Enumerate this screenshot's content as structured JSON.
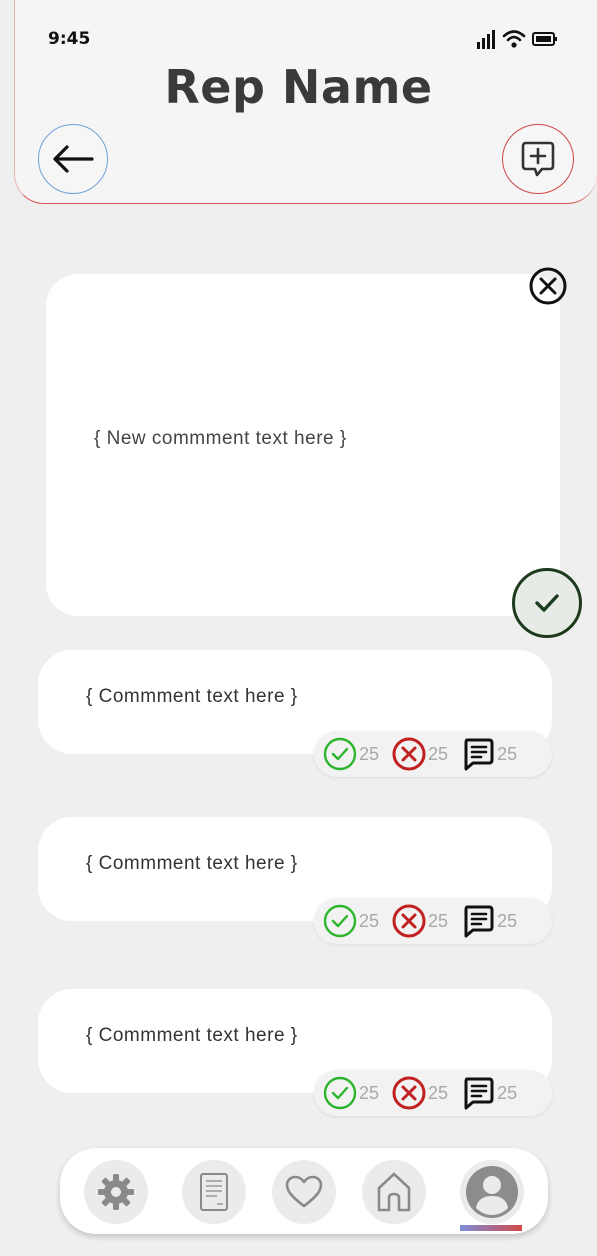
{
  "status_bar": {
    "time": "9:45"
  },
  "header": {
    "title": "Rep Name"
  },
  "new_comment": {
    "placeholder": "{ New commment text here }"
  },
  "comments": [
    {
      "text": "{ Commment text here }",
      "approve": "25",
      "reject": "25",
      "replies": "25"
    },
    {
      "text": "{ Commment text here }",
      "approve": "25",
      "reject": "25",
      "replies": "25"
    },
    {
      "text": "{ Commment text here }",
      "approve": "25",
      "reject": "25",
      "replies": "25"
    }
  ],
  "nav": [
    "settings-icon",
    "document-icon",
    "heart-icon",
    "home-icon",
    "profile-icon"
  ],
  "colors": {
    "accent_red": "#d04848",
    "accent_blue": "#6fa2d8",
    "approve_green": "#2db52d",
    "reject_red": "#c02020",
    "confirm_dark": "#1d3a1d"
  }
}
